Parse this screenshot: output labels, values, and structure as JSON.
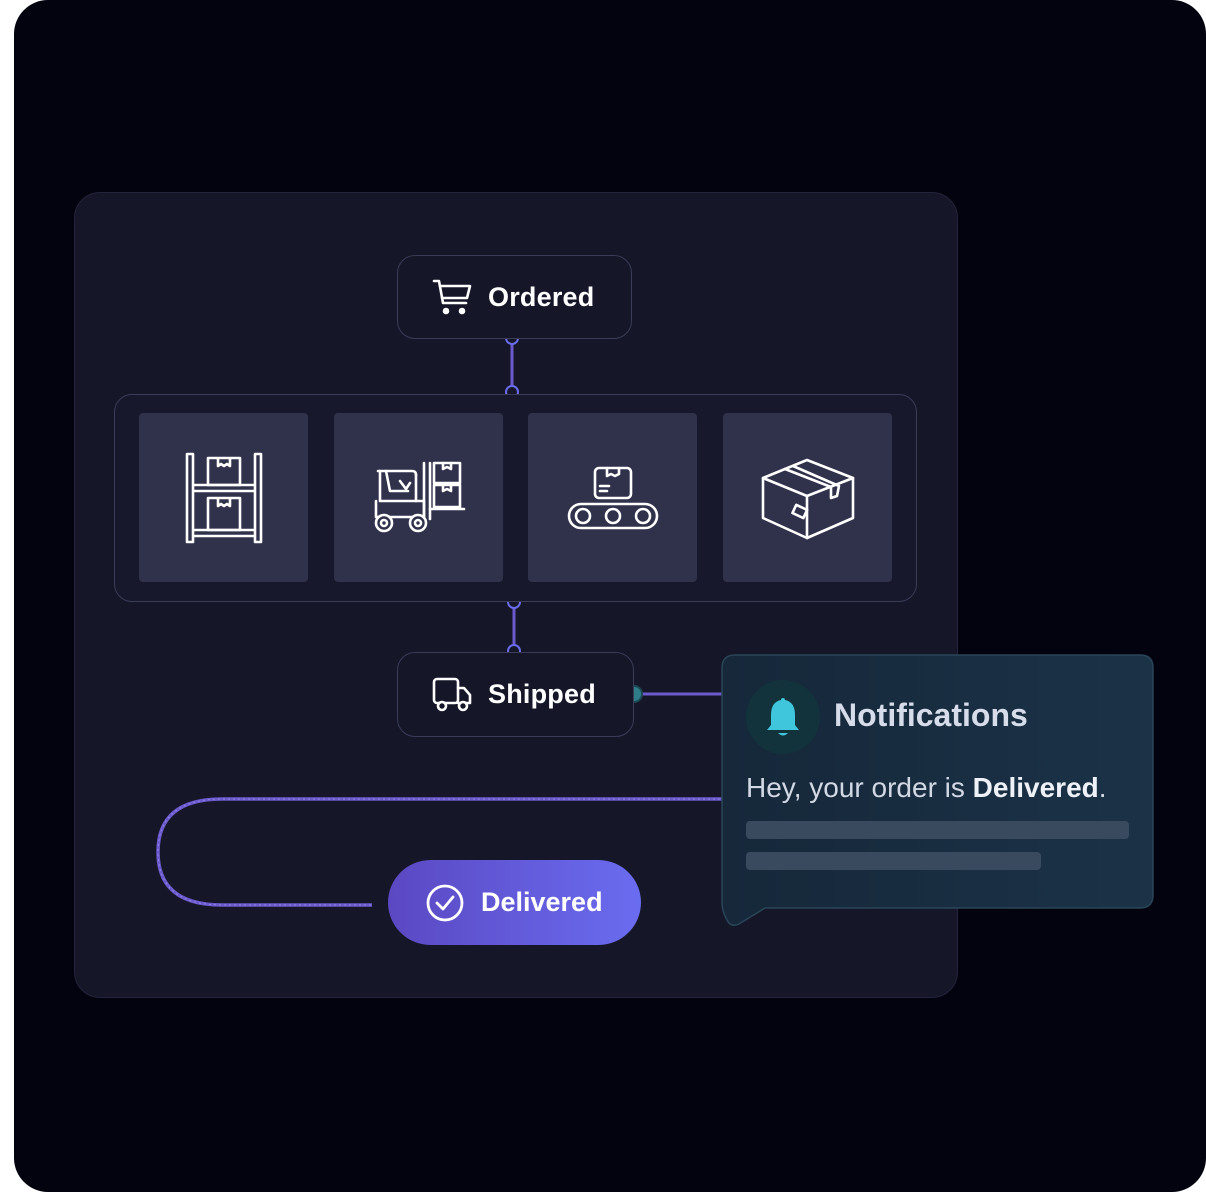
{
  "steps": {
    "ordered": {
      "label": "Ordered",
      "icon": "shopping-cart-icon"
    },
    "shipped": {
      "label": "Shipped",
      "icon": "delivery-truck-icon"
    },
    "delivered": {
      "label": "Delivered",
      "icon": "check-circle-icon"
    }
  },
  "stages": [
    {
      "icon": "warehouse-shelves-icon"
    },
    {
      "icon": "forklift-icon"
    },
    {
      "icon": "conveyor-belt-icon"
    },
    {
      "icon": "package-box-icon"
    }
  ],
  "notification": {
    "title": "Notifications",
    "message_prefix": "Hey, your order is ",
    "message_status": "Delivered",
    "message_suffix": ".",
    "icon": "bell-icon"
  },
  "colors": {
    "background": "#03030f",
    "panel": "#151628",
    "tile": "#30314a",
    "connector": "#6a5acd",
    "accent_start": "#5b48c2",
    "accent_end": "#6a6cf0",
    "notification_bg": "#16283a",
    "bell": "#3fc6dc"
  }
}
